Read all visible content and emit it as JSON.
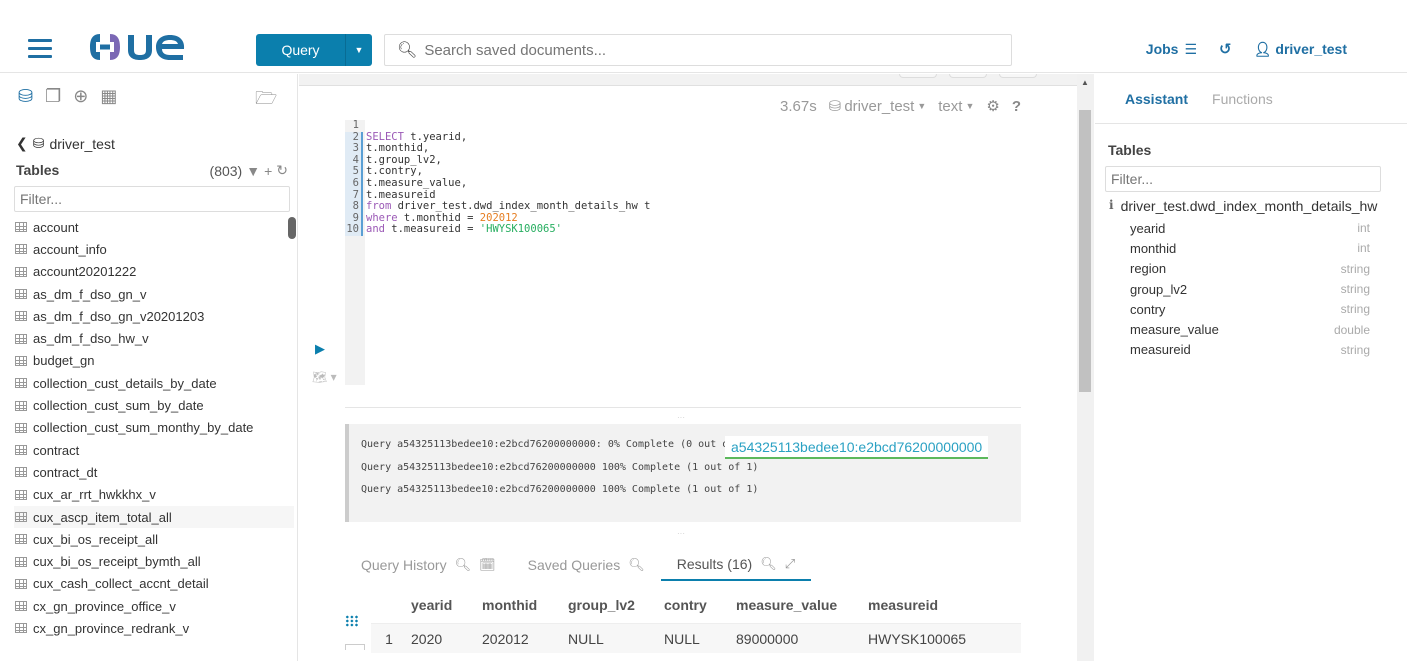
{
  "navbar": {
    "logo_text": "HUE",
    "query_button": "Query",
    "search_placeholder": "Search saved documents...",
    "jobs_label": "Jobs",
    "user_label": "driver_test"
  },
  "left_panel": {
    "database": "driver_test",
    "tables_title": "Tables",
    "tables_count": "(803)",
    "filter_placeholder": "Filter...",
    "tables": [
      "account",
      "account_info",
      "account20201222",
      "as_dm_f_dso_gn_v",
      "as_dm_f_dso_gn_v20201203",
      "as_dm_f_dso_hw_v",
      "budget_gn",
      "collection_cust_details_by_date",
      "collection_cust_sum_by_date",
      "collection_cust_sum_monthy_by_date",
      "contract",
      "contract_dt",
      "cux_ar_rrt_hwkkhx_v",
      "cux_ascp_item_total_all",
      "cux_bi_os_receipt_all",
      "cux_bi_os_receipt_bymth_all",
      "cux_cash_collect_accnt_detail",
      "cx_gn_province_office_v",
      "cx_gn_province_redrank_v"
    ],
    "hovered_table_index": 13
  },
  "editor": {
    "exec_time": "3.67s",
    "database": "driver_test",
    "format": "text",
    "lines": [
      {
        "n": "1",
        "parts": []
      },
      {
        "n": "2",
        "parts": [
          {
            "k": "kw",
            "t": "SELECT"
          },
          {
            "k": "",
            "t": " t.yearid,"
          }
        ]
      },
      {
        "n": "3",
        "parts": [
          {
            "k": "",
            "t": "t.monthid,"
          }
        ]
      },
      {
        "n": "4",
        "parts": [
          {
            "k": "",
            "t": "t.group_lv2,"
          }
        ]
      },
      {
        "n": "5",
        "parts": [
          {
            "k": "",
            "t": "t.contry,"
          }
        ]
      },
      {
        "n": "6",
        "parts": [
          {
            "k": "",
            "t": "t.measure_value,"
          }
        ]
      },
      {
        "n": "7",
        "parts": [
          {
            "k": "",
            "t": "t.measureid"
          }
        ]
      },
      {
        "n": "8",
        "parts": [
          {
            "k": "kw",
            "t": "from"
          },
          {
            "k": "",
            "t": " driver_test.dwd_index_month_details_hw t"
          }
        ]
      },
      {
        "n": "9",
        "parts": [
          {
            "k": "kw",
            "t": "where"
          },
          {
            "k": "",
            "t": " t.monthid = "
          },
          {
            "k": "num",
            "t": "202012"
          }
        ]
      },
      {
        "n": "10",
        "parts": [
          {
            "k": "kw",
            "t": "and"
          },
          {
            "k": "",
            "t": " t.measureid = "
          },
          {
            "k": "str",
            "t": "'HWYSK100065'"
          }
        ]
      }
    ]
  },
  "log": {
    "lines": [
      "Query a54325113bedee10:e2bcd76200000000: 0% Complete (0 out of 1)",
      "Query a54325113bedee10:e2bcd76200000000 100% Complete (1 out of 1)",
      "Query a54325113bedee10:e2bcd76200000000 100% Complete (1 out of 1)"
    ],
    "tooltip": "a54325113bedee10:e2bcd76200000000"
  },
  "results_tabs": {
    "history": "Query History",
    "saved": "Saved Queries",
    "results": "Results (16)"
  },
  "results": {
    "columns": [
      "yearid",
      "monthid",
      "group_lv2",
      "contry",
      "measure_value",
      "measureid"
    ],
    "rows": [
      [
        "1",
        "2020",
        "202012",
        "NULL",
        "NULL",
        "89000000",
        "HWYSK100065"
      ]
    ]
  },
  "right_panel": {
    "tabs": [
      "Assistant",
      "Functions"
    ],
    "tables_title": "Tables",
    "filter_placeholder": "Filter...",
    "table_name": "driver_test.dwd_index_month_details_hw",
    "columns": [
      {
        "name": "yearid",
        "type": "int"
      },
      {
        "name": "monthid",
        "type": "int"
      },
      {
        "name": "region",
        "type": "string"
      },
      {
        "name": "group_lv2",
        "type": "string"
      },
      {
        "name": "contry",
        "type": "string"
      },
      {
        "name": "measure_value",
        "type": "double"
      },
      {
        "name": "measureid",
        "type": "string"
      }
    ]
  },
  "colors": {
    "brand": "#0b7fad",
    "link": "#1f6fa3",
    "keyword": "#9b59b6",
    "number": "#e67e22",
    "string": "#27ae60"
  }
}
